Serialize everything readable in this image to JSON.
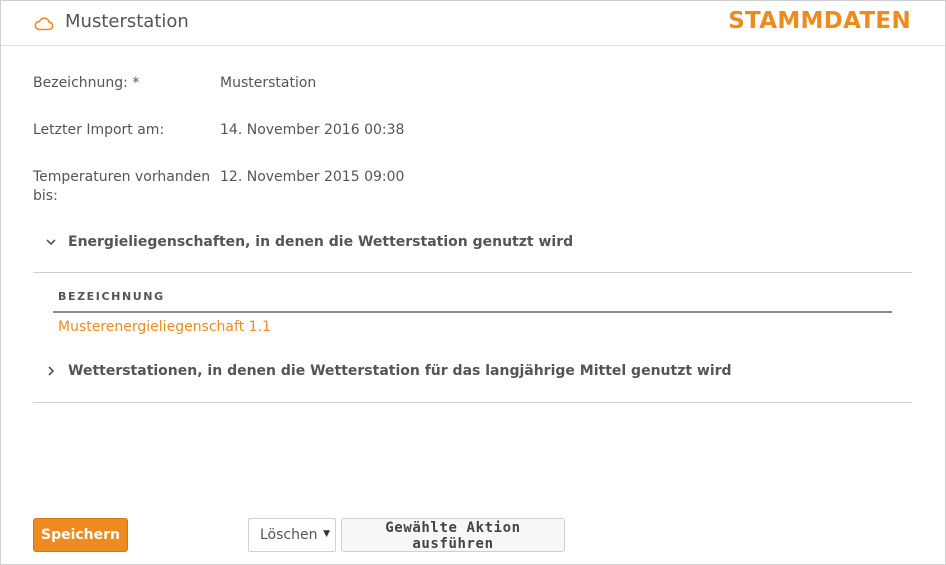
{
  "header": {
    "title": "Musterstation",
    "section": "STAMMDATEN"
  },
  "fields": [
    {
      "label": "Bezeichnung: *",
      "value": "Musterstation"
    },
    {
      "label": "Letzter Import am:",
      "value": "14. November 2016 00:38"
    },
    {
      "label": "Temperaturen vorhanden bis:",
      "value": "12. November 2015 09:00"
    }
  ],
  "sections": [
    {
      "label": "Energieliegenschaften, in denen die Wetterstation genutzt wird",
      "expanded": true,
      "table": {
        "column": "BEZEICHNUNG",
        "rows": [
          "Musterenergieliegenschaft 1.1"
        ]
      }
    },
    {
      "label": "Wetterstationen, in denen die Wetterstation für das langjährige Mittel genutzt wird",
      "expanded": false
    }
  ],
  "footer": {
    "save_label": "Speichern",
    "action_select_value": "Löschen",
    "execute_label": "Gewählte Aktion ausführen"
  },
  "colors": {
    "accent": "#ee8a1e",
    "text": "#555555",
    "border": "#cfcfcf"
  },
  "icons": {
    "title_icon": "cloud-icon",
    "expanded_icon": "chevron-down-icon",
    "collapsed_icon": "chevron-right-icon",
    "select_icon": "caret-down-icon"
  }
}
